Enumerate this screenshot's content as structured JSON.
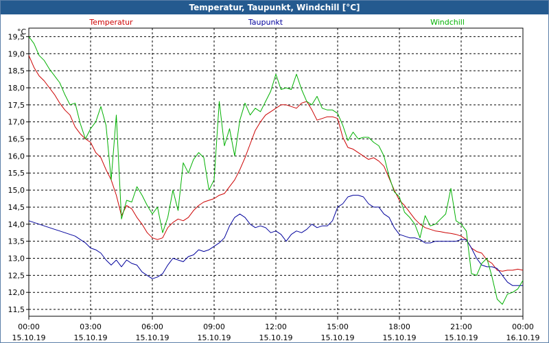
{
  "window": {
    "title": "Temperatur, Taupunkt, Windchill [°C]"
  },
  "chart_data": {
    "type": "line",
    "title": "Temperatur, Taupunkt, Windchill [°C]",
    "ylabel": "°C",
    "ylim": [
      11.3,
      19.75
    ],
    "y_ticks": [
      "11,5",
      "12,0",
      "12,5",
      "13,0",
      "13,5",
      "14,0",
      "14,5",
      "15,0",
      "15,5",
      "16,0",
      "16,5",
      "17,0",
      "17,5",
      "18,0",
      "18,5",
      "19,0",
      "19,5"
    ],
    "x_range_hours": [
      0,
      24
    ],
    "x_ticks": [
      {
        "time": "00:00",
        "date": "15.10.19"
      },
      {
        "time": "03:00",
        "date": "15.10.19"
      },
      {
        "time": "06:00",
        "date": "15.10.19"
      },
      {
        "time": "09:00",
        "date": "15.10.19"
      },
      {
        "time": "12:00",
        "date": "15.10.19"
      },
      {
        "time": "15:00",
        "date": "15.10.19"
      },
      {
        "time": "18:00",
        "date": "15.10.19"
      },
      {
        "time": "21:00",
        "date": "15.10.19"
      },
      {
        "time": "00:00",
        "date": "16.10.19"
      }
    ],
    "grid": true,
    "series": [
      {
        "name": "Temperatur",
        "color": "#cc0000",
        "x": [
          0,
          0.25,
          0.5,
          0.75,
          1,
          1.25,
          1.5,
          1.75,
          2,
          2.25,
          2.5,
          2.75,
          3,
          3.25,
          3.5,
          3.75,
          4,
          4.25,
          4.5,
          4.75,
          5,
          5.25,
          5.5,
          5.75,
          6,
          6.25,
          6.5,
          6.75,
          7,
          7.25,
          7.5,
          7.75,
          8,
          8.25,
          8.5,
          8.75,
          9,
          9.25,
          9.5,
          9.75,
          10,
          10.25,
          10.5,
          10.75,
          11,
          11.25,
          11.5,
          11.75,
          12,
          12.25,
          12.5,
          12.75,
          13,
          13.25,
          13.5,
          13.75,
          14,
          14.25,
          14.5,
          14.75,
          15,
          15.25,
          15.5,
          15.75,
          16,
          16.25,
          16.5,
          16.75,
          17,
          17.25,
          17.5,
          17.75,
          18,
          18.25,
          18.5,
          18.75,
          19,
          19.25,
          19.5,
          19.75,
          20,
          20.25,
          20.5,
          20.75,
          21,
          21.25,
          21.5,
          21.75,
          22,
          22.25,
          22.5,
          22.75,
          23,
          23.25,
          23.5,
          23.75,
          24
        ],
        "values": [
          18.95,
          18.6,
          18.35,
          18.2,
          18.0,
          17.8,
          17.55,
          17.35,
          17.2,
          16.85,
          16.65,
          16.5,
          16.4,
          16.1,
          15.95,
          15.6,
          15.3,
          14.85,
          14.25,
          14.55,
          14.45,
          14.2,
          14.0,
          13.75,
          13.6,
          13.55,
          13.6,
          13.9,
          14.05,
          14.15,
          14.1,
          14.2,
          14.4,
          14.55,
          14.65,
          14.7,
          14.75,
          14.85,
          14.9,
          15.1,
          15.3,
          15.6,
          15.95,
          16.35,
          16.75,
          17.0,
          17.2,
          17.3,
          17.4,
          17.5,
          17.5,
          17.45,
          17.4,
          17.55,
          17.6,
          17.35,
          17.05,
          17.1,
          17.15,
          17.15,
          17.1,
          16.55,
          16.25,
          16.2,
          16.1,
          16.0,
          15.9,
          15.95,
          15.85,
          15.7,
          15.35,
          15.0,
          14.7,
          14.55,
          14.35,
          14.15,
          14.0,
          13.9,
          13.85,
          13.8,
          13.78,
          13.75,
          13.73,
          13.7,
          13.65,
          13.55,
          13.3,
          13.2,
          13.15,
          12.95,
          12.85,
          12.65,
          12.62,
          12.65,
          12.65,
          12.68,
          12.65
        ]
      },
      {
        "name": "Taupunkt",
        "color": "#00009c",
        "x": [
          0,
          0.25,
          0.5,
          0.75,
          1,
          1.25,
          1.5,
          1.75,
          2,
          2.25,
          2.5,
          2.75,
          3,
          3.25,
          3.5,
          3.75,
          4,
          4.25,
          4.5,
          4.75,
          5,
          5.25,
          5.5,
          5.75,
          6,
          6.25,
          6.5,
          6.75,
          7,
          7.25,
          7.5,
          7.75,
          8,
          8.25,
          8.5,
          8.75,
          9,
          9.25,
          9.5,
          9.75,
          10,
          10.25,
          10.5,
          10.75,
          11,
          11.25,
          11.5,
          11.75,
          12,
          12.25,
          12.5,
          12.75,
          13,
          13.25,
          13.5,
          13.75,
          14,
          14.25,
          14.5,
          14.75,
          15,
          15.25,
          15.5,
          15.75,
          16,
          16.25,
          16.5,
          16.75,
          17,
          17.25,
          17.5,
          17.75,
          18,
          18.25,
          18.5,
          18.75,
          19,
          19.25,
          19.5,
          19.75,
          20,
          20.25,
          20.5,
          20.75,
          21,
          21.25,
          21.5,
          21.75,
          22,
          22.25,
          22.5,
          22.75,
          23,
          23.25,
          23.5,
          23.75,
          24
        ],
        "values": [
          14.1,
          14.05,
          14.0,
          13.95,
          13.9,
          13.85,
          13.8,
          13.75,
          13.7,
          13.65,
          13.55,
          13.45,
          13.3,
          13.25,
          13.15,
          12.95,
          12.8,
          12.95,
          12.75,
          12.95,
          12.85,
          12.8,
          12.6,
          12.5,
          12.4,
          12.45,
          12.55,
          12.8,
          13.0,
          12.95,
          12.9,
          13.05,
          13.1,
          13.25,
          13.2,
          13.25,
          13.35,
          13.45,
          13.6,
          13.95,
          14.2,
          14.3,
          14.2,
          14.0,
          13.9,
          13.95,
          13.9,
          13.75,
          13.8,
          13.7,
          13.5,
          13.7,
          13.8,
          13.75,
          13.85,
          14.0,
          13.9,
          13.95,
          13.95,
          14.1,
          14.5,
          14.6,
          14.8,
          14.85,
          14.85,
          14.8,
          14.6,
          14.5,
          14.5,
          14.3,
          14.2,
          13.9,
          13.7,
          13.65,
          13.6,
          13.6,
          13.55,
          13.45,
          13.45,
          13.5,
          13.5,
          13.5,
          13.5,
          13.5,
          13.55,
          13.55,
          13.3,
          13.0,
          12.8,
          12.75,
          12.75,
          12.7,
          12.5,
          12.3,
          12.2,
          12.2,
          12.2
        ]
      },
      {
        "name": "Windchill",
        "color": "#00b000",
        "x": [
          0,
          0.25,
          0.5,
          0.75,
          1,
          1.25,
          1.5,
          1.75,
          2,
          2.25,
          2.5,
          2.75,
          3,
          3.25,
          3.5,
          3.75,
          4,
          4.25,
          4.5,
          4.75,
          5,
          5.25,
          5.5,
          5.75,
          6,
          6.25,
          6.5,
          6.75,
          7,
          7.25,
          7.5,
          7.75,
          8,
          8.25,
          8.5,
          8.75,
          9,
          9.25,
          9.5,
          9.75,
          10,
          10.25,
          10.5,
          10.75,
          11,
          11.25,
          11.5,
          11.75,
          12,
          12.25,
          12.5,
          12.75,
          13,
          13.25,
          13.5,
          13.75,
          14,
          14.25,
          14.5,
          14.75,
          15,
          15.25,
          15.5,
          15.75,
          16,
          16.25,
          16.5,
          16.75,
          17,
          17.25,
          17.5,
          17.75,
          18,
          18.25,
          18.5,
          18.75,
          19,
          19.25,
          19.5,
          19.75,
          20,
          20.25,
          20.5,
          20.75,
          21,
          21.25,
          21.5,
          21.75,
          22,
          22.25,
          22.5,
          22.75,
          23,
          23.25,
          23.5,
          23.75,
          24
        ],
        "values": [
          19.5,
          19.3,
          18.95,
          18.8,
          18.55,
          18.35,
          18.15,
          17.8,
          17.5,
          17.55,
          16.95,
          16.5,
          16.8,
          17.0,
          17.45,
          16.9,
          15.3,
          17.2,
          14.15,
          14.7,
          14.65,
          15.1,
          14.85,
          14.55,
          14.3,
          14.5,
          13.75,
          14.2,
          15.0,
          14.4,
          15.8,
          15.5,
          15.9,
          16.1,
          15.95,
          15.0,
          15.3,
          17.6,
          16.3,
          16.8,
          16.0,
          17.05,
          17.55,
          17.2,
          17.4,
          17.3,
          17.6,
          17.9,
          18.4,
          17.95,
          18.0,
          17.95,
          18.4,
          17.95,
          17.6,
          17.5,
          17.75,
          17.4,
          17.35,
          17.35,
          17.25,
          16.9,
          16.45,
          16.7,
          16.5,
          16.55,
          16.55,
          16.4,
          16.3,
          16.0,
          15.4,
          14.95,
          14.8,
          14.35,
          14.2,
          14.0,
          13.6,
          14.25,
          13.95,
          14.0,
          14.15,
          14.3,
          15.05,
          14.1,
          14.0,
          13.8,
          12.55,
          12.5,
          12.85,
          13.0,
          12.45,
          11.8,
          11.65,
          11.95,
          12.0,
          12.1,
          12.35
        ]
      }
    ]
  }
}
